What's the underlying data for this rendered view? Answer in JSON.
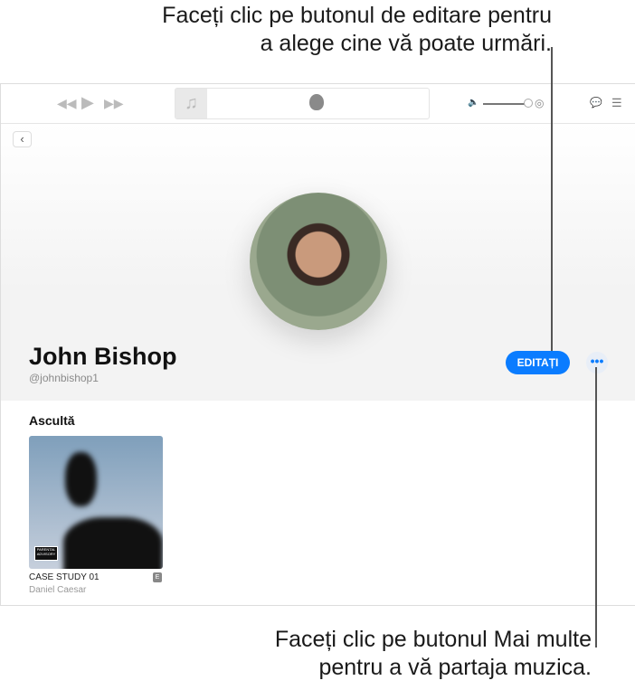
{
  "callouts": {
    "edit": [
      "Faceți clic pe butonul de editare pentru",
      "a alege cine vă poate urmări."
    ],
    "more": [
      "Faceți clic pe butonul Mai multe",
      "pentru a vă partaja muzica."
    ]
  },
  "profile": {
    "name": "John Bishop",
    "handle": "@johnbishop1",
    "edit_label": "EDITAȚI",
    "more_label": "•••"
  },
  "section": {
    "title": "Ascultă",
    "albums": [
      {
        "title": "CASE STUDY 01",
        "artist": "Daniel Caesar",
        "explicit": "E",
        "advisory": "PARENTAL ADVISORY"
      }
    ]
  },
  "toolbar": {
    "volume": 0.9
  }
}
